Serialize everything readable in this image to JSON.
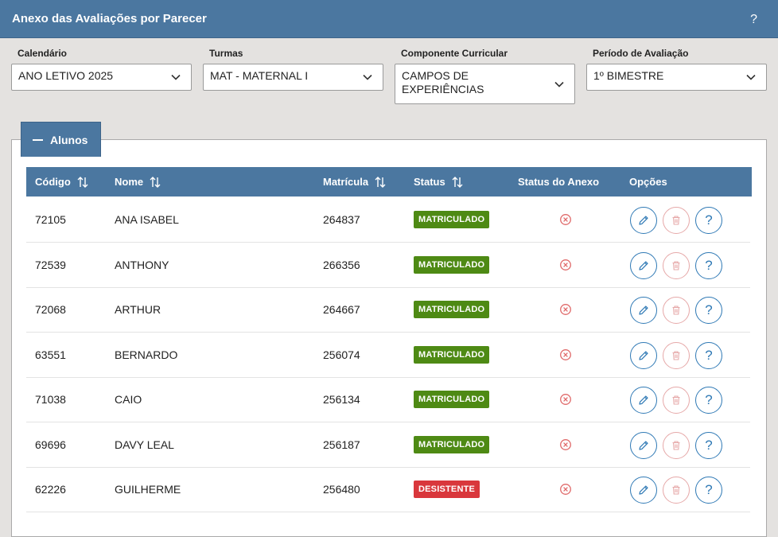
{
  "header": {
    "title": "Anexo das Avaliações por Parecer",
    "help": "?"
  },
  "filters": [
    {
      "label": "Calendário",
      "value": "ANO LETIVO 2025"
    },
    {
      "label": "Turmas",
      "value": "MAT - MATERNAL I"
    },
    {
      "label": "Componente Curricular",
      "value": "CAMPOS DE EXPERIÊNCIAS"
    },
    {
      "label": "Período de Avaliação",
      "value": "1º BIMESTRE"
    }
  ],
  "section": {
    "title": "Alunos"
  },
  "table": {
    "columns": [
      "Código",
      "Nome",
      "Matrícula",
      "Status",
      "Status do Anexo",
      "Opções"
    ],
    "rows": [
      {
        "codigo": "72105",
        "nome": "ANA ISABEL",
        "matricula": "264837",
        "status": "MATRICULADO"
      },
      {
        "codigo": "72539",
        "nome": "ANTHONY",
        "matricula": "266356",
        "status": "MATRICULADO"
      },
      {
        "codigo": "72068",
        "nome": "ARTHUR",
        "matricula": "264667",
        "status": "MATRICULADO"
      },
      {
        "codigo": "63551",
        "nome": "BERNARDO",
        "matricula": "256074",
        "status": "MATRICULADO"
      },
      {
        "codigo": "71038",
        "nome": "CAIO",
        "matricula": "256134",
        "status": "MATRICULADO"
      },
      {
        "codigo": "69696",
        "nome": "DAVY LEAL",
        "matricula": "256187",
        "status": "MATRICULADO"
      },
      {
        "codigo": "62226",
        "nome": "GUILHERME",
        "matricula": "256480",
        "status": "DESISTENTE"
      }
    ],
    "help_label": "?"
  },
  "colors": {
    "header": "#4b77a0",
    "matriculado": "#4e8a14",
    "desistente": "#d9373c",
    "primary": "#2f79b5",
    "danger": "#e06a6a"
  }
}
